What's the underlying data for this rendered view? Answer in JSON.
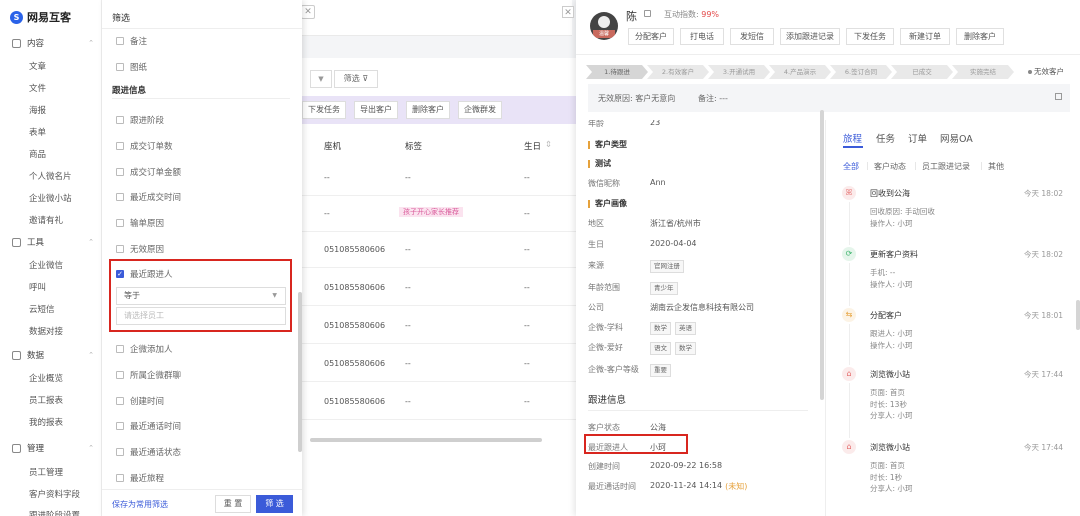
{
  "app": {
    "logo": "网易互客"
  },
  "sidebar": {
    "groups": [
      {
        "label": "内容",
        "items": [
          "文章",
          "文件",
          "海报",
          "表单",
          "商品",
          "个人微名片",
          "企业微小站",
          "邀请有礼"
        ]
      },
      {
        "label": "工具",
        "items": [
          "企业微信",
          "呼叫",
          "云短信",
          "数据对接"
        ]
      },
      {
        "label": "数据",
        "items": [
          "企业概览",
          "员工报表",
          "我的报表"
        ]
      },
      {
        "label": "管理",
        "items": [
          "员工管理",
          "客户资料字段",
          "跟进阶段设置"
        ]
      }
    ]
  },
  "background": {
    "filter_label": "筛选",
    "dropdown_arrow": "▼",
    "actions": [
      "下发任务",
      "导出客户",
      "删除客户",
      "企微群发"
    ],
    "columns": [
      "座机",
      "标签",
      "生日"
    ],
    "rows": [
      {
        "phone": "--",
        "tag": "--",
        "birthday": "--"
      },
      {
        "phone": "--",
        "tag": "孩子开心家长推荐",
        "birthday": "--"
      },
      {
        "phone": "051085580606",
        "tag": "--",
        "birthday": "--"
      },
      {
        "phone": "051085580606",
        "tag": "--",
        "birthday": "--"
      },
      {
        "phone": "051085580606",
        "tag": "--",
        "birthday": "--"
      },
      {
        "phone": "051085580606",
        "tag": "--",
        "birthday": "--"
      },
      {
        "phone": "051085580606",
        "tag": "--",
        "birthday": "--"
      }
    ]
  },
  "filter_panel": {
    "title": "筛选",
    "top_items": [
      "备注",
      "图纸"
    ],
    "section_title": "跟进信息",
    "items_before": [
      "跟进阶段",
      "成交订单数",
      "成交订单金额",
      "最近成交时间",
      "输单原因",
      "无效原因"
    ],
    "checked_item": "最近跟进人",
    "operator_value": "等于",
    "staff_placeholder": "请选择员工",
    "items_after": [
      "企微添加人",
      "所属企微群聊",
      "创建时间",
      "最近通话时间",
      "最近通话状态",
      "最近旅程"
    ],
    "save_label": "保存为常用筛选",
    "reset_label": "重 置",
    "confirm_label": "筛 选",
    "highlight_color": "#d8261f",
    "accent_color": "#3b5bd9"
  },
  "detail": {
    "customer_name": "陈",
    "avatar_label": "温馨",
    "index_label": "互动指数:",
    "index_value": "99%",
    "actions": [
      "分配客户",
      "打电话",
      "发短信",
      "添加跟进记录",
      "下发任务",
      "新建订单",
      "删除客户"
    ],
    "stages": [
      "1.待跟进",
      "2.有效客户",
      "3.开通试用",
      "4.产品演示",
      "6.签订合同",
      "已成交",
      "实施完结"
    ],
    "status": "无效客户",
    "invalid_reason": "无效原因: 客户无意向",
    "remark": "备注: ---",
    "left": {
      "partial_row": {
        "k": "年龄",
        "v": "23"
      },
      "sec_type": "客户类型",
      "sec_test": "测试",
      "wechat": {
        "k": "微信昵称",
        "v": "Ann"
      },
      "sec_portrait": "客户画像",
      "rows": [
        {
          "k": "地区",
          "v": "浙江省/杭州市"
        },
        {
          "k": "生日",
          "v": "2020-04-04"
        },
        {
          "k": "来源",
          "chips": [
            "官网注册"
          ]
        },
        {
          "k": "年龄范围",
          "chips": [
            "青少年"
          ]
        },
        {
          "k": "公司",
          "v": "湖南云企发信息科技有限公司"
        },
        {
          "k": "企微-学科",
          "chips": [
            "数学",
            "英语"
          ]
        },
        {
          "k": "企微-爱好",
          "chips": [
            "语文",
            "数学"
          ]
        },
        {
          "k": "企微-客户等级",
          "chips": [
            "重要"
          ]
        }
      ],
      "follow_title": "跟进信息",
      "follow_rows": [
        {
          "k": "客户状态",
          "v": "公海"
        },
        {
          "k": "最近跟进人",
          "v": "小珂"
        },
        {
          "k": "创建时间",
          "v": "2020-09-22 16:58"
        },
        {
          "k": "最近通话时间",
          "v": "2020-11-24 14:14",
          "note": "(未知)"
        }
      ]
    },
    "right": {
      "tabs": [
        "旅程",
        "任务",
        "订单",
        "网易OA"
      ],
      "filters": [
        "全部",
        "客户动态",
        "员工跟进记录",
        "其他"
      ],
      "timeline": [
        {
          "icon": "ꕤ",
          "color": "#e46a6a",
          "title": "回收到公海",
          "time": "今天 18:02",
          "lines": [
            "回收原因: 手动回收",
            "操作人: 小珂"
          ]
        },
        {
          "icon": "⟳",
          "color": "#3bb36b",
          "title": "更新客户资料",
          "time": "今天 18:02",
          "lines": [
            "手机: --",
            "操作人: 小珂"
          ]
        },
        {
          "icon": "⇆",
          "color": "#e6a23c",
          "title": "分配客户",
          "time": "今天 18:01",
          "lines": [
            "跟进人: 小珂",
            "操作人: 小珂"
          ]
        },
        {
          "icon": "⌂",
          "color": "#e46a6a",
          "title": "浏览微小站",
          "time": "今天 17:44",
          "lines": [
            "页面: 首页",
            "时长: 13秒",
            "分享人: 小珂"
          ]
        },
        {
          "icon": "⌂",
          "color": "#e46a6a",
          "title": "浏览微小站",
          "time": "今天 17:44",
          "lines": [
            "页面: 首页",
            "时长: 1秒",
            "分享人: 小珂"
          ]
        }
      ]
    }
  }
}
